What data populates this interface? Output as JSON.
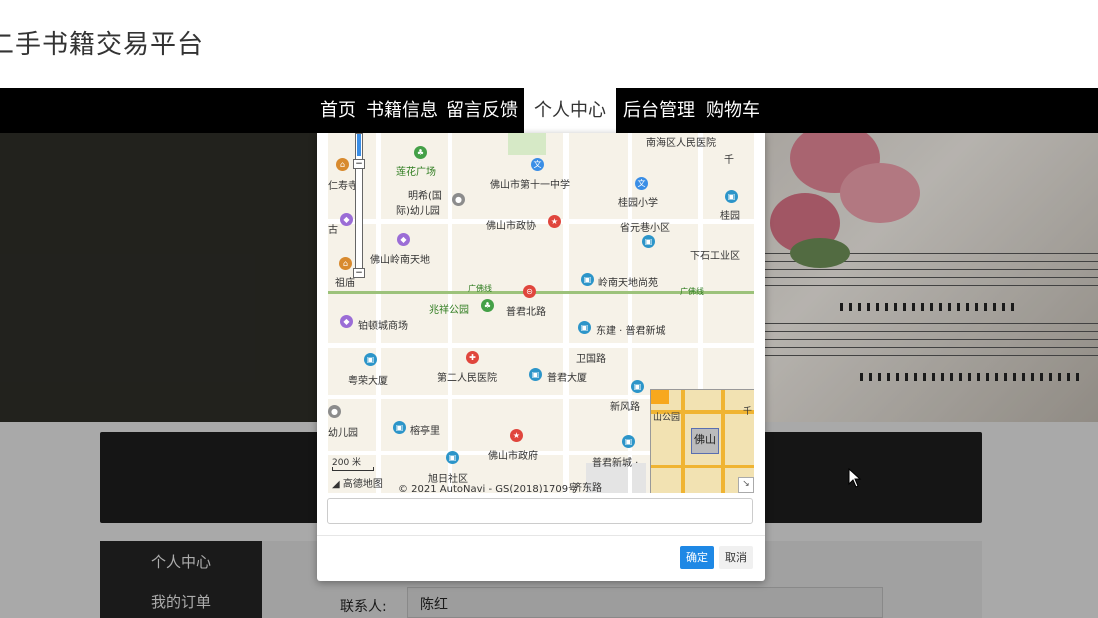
{
  "site": {
    "title": "二手书籍交易平台"
  },
  "nav": {
    "items": [
      {
        "label": "首页"
      },
      {
        "label": "书籍信息"
      },
      {
        "label": "留言反馈"
      },
      {
        "label": "个人中心"
      },
      {
        "label": "后台管理"
      },
      {
        "label": "购物车"
      }
    ],
    "active": "个人中心"
  },
  "sidebar": {
    "items": [
      {
        "label": "个人中心"
      },
      {
        "label": "我的订单"
      }
    ]
  },
  "form": {
    "contact_label": "联系人:",
    "contact_value": "陈红"
  },
  "map": {
    "pois": [
      {
        "text": "南海区人民医院"
      },
      {
        "text": "莲花广场"
      },
      {
        "text": "仁寿寺"
      },
      {
        "text": "佛山市第十一中学"
      },
      {
        "text": "明希(国"
      },
      {
        "text": "际)幼儿园"
      },
      {
        "text": "桂园小学"
      },
      {
        "text": "桂园"
      },
      {
        "text": "佛山市政协"
      },
      {
        "text": "省元巷小区"
      },
      {
        "text": "佛山岭南天地"
      },
      {
        "text": "下石工业区"
      },
      {
        "text": "祖庙"
      },
      {
        "text": "岭南天地尚苑"
      },
      {
        "text": "兆祥公园"
      },
      {
        "text": "普君北路"
      },
      {
        "text": "铂顿城商场"
      },
      {
        "text": "东建 · 普君新城"
      },
      {
        "text": "卫国路"
      },
      {
        "text": "粤荣大厦"
      },
      {
        "text": "第二人民医院"
      },
      {
        "text": "普君大厦"
      },
      {
        "text": "新风路"
      },
      {
        "text": "幼儿园"
      },
      {
        "text": "榕亭里"
      },
      {
        "text": "佛山市政府"
      },
      {
        "text": "普君新城 ·"
      },
      {
        "text": "旭日社区"
      },
      {
        "text": "济东路"
      },
      {
        "text": "广佛线"
      },
      {
        "text": "广佛线"
      },
      {
        "text": "千"
      },
      {
        "text": "古"
      }
    ],
    "scale_label": "200 米",
    "logo_text": "高德地图",
    "copyright": "© 2021 AutoNavi - GS(2018)1709号",
    "minimap_label": "佛山",
    "minimap_park": "山公园",
    "minimap_extra": "千"
  },
  "dialog": {
    "address_value": "",
    "confirm_label": "确定",
    "cancel_label": "取消"
  },
  "colors": {
    "navbar": "#000000",
    "accent": "#1e88e5",
    "hero": "#2c2c26",
    "sidebar": "#222222"
  },
  "icons": [
    "mouse-pointer-icon",
    "zoom-in-icon",
    "zoom-out-icon",
    "collapse-icon",
    "amap-logo-icon"
  ]
}
